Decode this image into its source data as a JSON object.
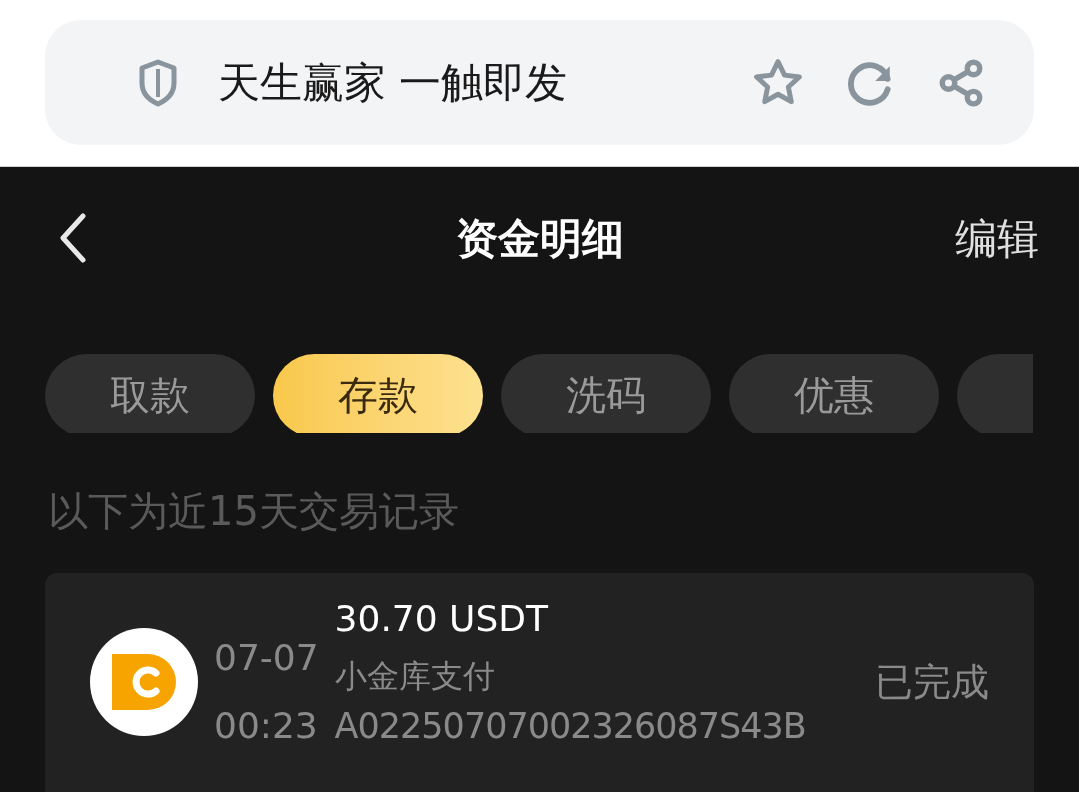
{
  "browser_bar": {
    "title": "天生赢家 一触即发"
  },
  "header": {
    "title": "资金明细",
    "action": "编辑"
  },
  "tabs": [
    {
      "label": "取款",
      "selected": false
    },
    {
      "label": "存款",
      "selected": true
    },
    {
      "label": "洗码",
      "selected": false
    },
    {
      "label": "优惠",
      "selected": false
    },
    {
      "selected": false
    }
  ],
  "notice": "以下为近15天交易记录",
  "records": [
    {
      "date": "07-07",
      "time": "00:23",
      "amount": "30.70 USDT",
      "method": "小金库支付",
      "order_id": "A02250707002326087S43B",
      "status": "已完成"
    }
  ]
}
